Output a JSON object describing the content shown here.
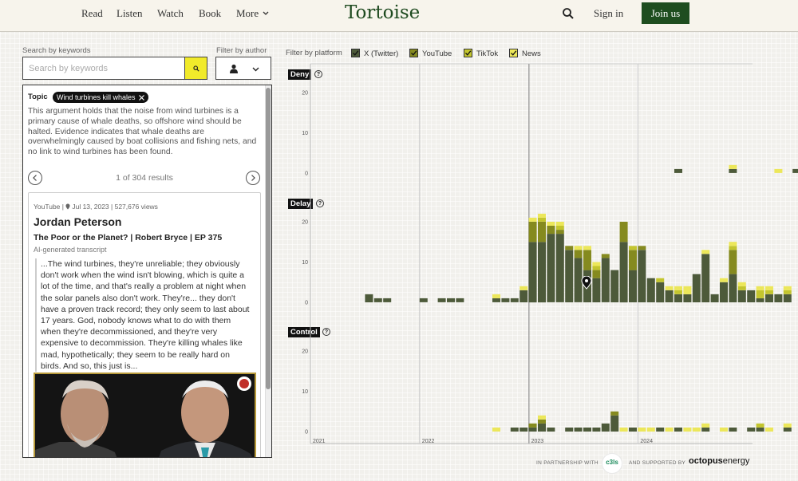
{
  "nav": {
    "items": [
      "Read",
      "Listen",
      "Watch",
      "Book",
      "More"
    ],
    "logo": "Tortoise",
    "sign_in": "Sign in",
    "join": "Join us"
  },
  "search": {
    "label": "Search by keywords",
    "placeholder": "Search by keywords",
    "author_label": "Filter by author"
  },
  "topic": {
    "label": "Topic",
    "tag": "Wind turbines kill whales",
    "description": "This argument holds that the noise from wind turbines is a primary cause of whale deaths, so offshore wind should be halted. Evidence indicates that whale deaths are overwhelmingly caused by boat collisions and fishing nets, and no link to wind turbines has been found.",
    "results": "1 of 304 results"
  },
  "result": {
    "meta": "YouTube | ",
    "date": "Jul 13, 2023 | 527,676 views",
    "author": "Jordan Peterson",
    "title": "The Poor or the Planet? | Robert Bryce | EP 375",
    "transcript_label": "AI-generated transcript",
    "quote": "...The wind turbines, they're unreliable; they obviously don't work when the wind isn't blowing, which is quite a lot of the time, and that's really a problem at night when the solar panels also don't work. They're... they don't have a proven track record; they only seem to last about 17 years. God, nobody knows what to do with them when they're decommissioned, and they're very expensive to decommission. They're killing whales like mad, hypothetically; they seem to be really hard on birds. And so, this just is..."
  },
  "filters": {
    "label": "Filter by platform",
    "platforms": [
      {
        "name": "X (Twitter)",
        "color": "#4d5a3a"
      },
      {
        "name": "YouTube",
        "color": "#858a1f"
      },
      {
        "name": "TikTok",
        "color": "#c3c52e"
      },
      {
        "name": "News",
        "color": "#ece75a"
      }
    ]
  },
  "chart_data": {
    "type": "stacked bar",
    "x_axis": [
      "2021",
      "2022",
      "2023",
      "2024"
    ],
    "y_ticks": [
      "0",
      "10",
      "20"
    ],
    "ylim": [
      0,
      22
    ],
    "series": [
      "X (Twitter)",
      "YouTube",
      "TikTok",
      "News"
    ],
    "panels": [
      {
        "name": "Deny",
        "bars": [
          {
            "month": 40,
            "values": [
              1,
              0,
              0,
              0
            ]
          },
          {
            "month": 46,
            "values": [
              1,
              0,
              0,
              1
            ]
          },
          {
            "month": 51,
            "values": [
              0,
              0,
              0,
              1
            ]
          },
          {
            "month": 53,
            "values": [
              1,
              0,
              0,
              0
            ]
          }
        ]
      },
      {
        "name": "Delay",
        "bars": [
          {
            "month": 6,
            "values": [
              2,
              0,
              0,
              0
            ]
          },
          {
            "month": 7,
            "values": [
              1,
              0,
              0,
              0
            ]
          },
          {
            "month": 8,
            "values": [
              1,
              0,
              0,
              0
            ]
          },
          {
            "month": 12,
            "values": [
              1,
              0,
              0,
              0
            ]
          },
          {
            "month": 14,
            "values": [
              1,
              0,
              0,
              0
            ]
          },
          {
            "month": 15,
            "values": [
              1,
              0,
              0,
              0
            ]
          },
          {
            "month": 16,
            "values": [
              1,
              0,
              0,
              0
            ]
          },
          {
            "month": 20,
            "values": [
              1,
              0,
              0,
              1
            ]
          },
          {
            "month": 21,
            "values": [
              1,
              0,
              0,
              0
            ]
          },
          {
            "month": 22,
            "values": [
              1,
              0,
              0,
              0
            ]
          },
          {
            "month": 23,
            "values": [
              3,
              0,
              0,
              1
            ]
          },
          {
            "month": 24,
            "values": [
              15,
              5,
              0,
              1
            ]
          },
          {
            "month": 25,
            "values": [
              15,
              5,
              1,
              1
            ]
          },
          {
            "month": 26,
            "values": [
              17,
              2,
              0,
              1
            ]
          },
          {
            "month": 27,
            "values": [
              17,
              1,
              1,
              1
            ]
          },
          {
            "month": 28,
            "values": [
              13,
              1,
              0,
              0
            ]
          },
          {
            "month": 29,
            "values": [
              11,
              2,
              0,
              1
            ]
          },
          {
            "month": 30,
            "values": [
              8,
              5,
              0,
              1
            ]
          },
          {
            "month": 31,
            "values": [
              6,
              2,
              1,
              1
            ]
          },
          {
            "month": 32,
            "values": [
              11,
              1,
              0,
              0
            ]
          },
          {
            "month": 33,
            "values": [
              8,
              0,
              0,
              0
            ]
          },
          {
            "month": 34,
            "values": [
              15,
              5,
              0,
              0
            ]
          },
          {
            "month": 35,
            "values": [
              8,
              5,
              1,
              0
            ]
          },
          {
            "month": 36,
            "values": [
              13,
              1,
              0,
              0
            ]
          },
          {
            "month": 37,
            "values": [
              6,
              0,
              0,
              0
            ]
          },
          {
            "month": 38,
            "values": [
              5,
              0,
              1,
              0
            ]
          },
          {
            "month": 39,
            "values": [
              3,
              0,
              0,
              1
            ]
          },
          {
            "month": 40,
            "values": [
              2,
              0,
              1,
              1
            ]
          },
          {
            "month": 41,
            "values": [
              2,
              0,
              0,
              2
            ]
          },
          {
            "month": 42,
            "values": [
              7,
              0,
              0,
              0
            ]
          },
          {
            "month": 43,
            "values": [
              12,
              0,
              0,
              1
            ]
          },
          {
            "month": 44,
            "values": [
              2,
              0,
              0,
              0
            ]
          },
          {
            "month": 45,
            "values": [
              5,
              0,
              0,
              1
            ]
          },
          {
            "month": 46,
            "values": [
              7,
              6,
              1,
              1
            ]
          },
          {
            "month": 47,
            "values": [
              3,
              0,
              1,
              1
            ]
          },
          {
            "month": 48,
            "values": [
              3,
              0,
              0,
              0
            ]
          },
          {
            "month": 49,
            "values": [
              1,
              0,
              2,
              1
            ]
          },
          {
            "month": 50,
            "values": [
              2,
              0,
              1,
              1
            ]
          },
          {
            "month": 51,
            "values": [
              2,
              0,
              0,
              0
            ]
          },
          {
            "month": 52,
            "values": [
              2,
              0,
              1,
              1
            ]
          }
        ]
      },
      {
        "name": "Control",
        "bars": [
          {
            "month": 20,
            "values": [
              0,
              0,
              0,
              1
            ]
          },
          {
            "month": 22,
            "values": [
              1,
              0,
              0,
              0
            ]
          },
          {
            "month": 23,
            "values": [
              1,
              0,
              0,
              0
            ]
          },
          {
            "month": 24,
            "values": [
              1,
              1,
              0,
              0
            ]
          },
          {
            "month": 25,
            "values": [
              2,
              1,
              0,
              1
            ]
          },
          {
            "month": 26,
            "values": [
              1,
              0,
              0,
              0
            ]
          },
          {
            "month": 28,
            "values": [
              1,
              0,
              0,
              0
            ]
          },
          {
            "month": 29,
            "values": [
              1,
              0,
              0,
              0
            ]
          },
          {
            "month": 30,
            "values": [
              1,
              0,
              0,
              0
            ]
          },
          {
            "month": 31,
            "values": [
              1,
              0,
              0,
              0
            ]
          },
          {
            "month": 32,
            "values": [
              2,
              0,
              0,
              0
            ]
          },
          {
            "month": 33,
            "values": [
              4,
              1,
              0,
              0
            ]
          },
          {
            "month": 34,
            "values": [
              0,
              0,
              0,
              1
            ]
          },
          {
            "month": 35,
            "values": [
              1,
              0,
              0,
              0
            ]
          },
          {
            "month": 36,
            "values": [
              0,
              0,
              0,
              1
            ]
          },
          {
            "month": 37,
            "values": [
              0,
              0,
              0,
              1
            ]
          },
          {
            "month": 38,
            "values": [
              1,
              0,
              0,
              0
            ]
          },
          {
            "month": 39,
            "values": [
              0,
              0,
              0,
              1
            ]
          },
          {
            "month": 40,
            "values": [
              1,
              0,
              0,
              0
            ]
          },
          {
            "month": 41,
            "values": [
              0,
              0,
              0,
              1
            ]
          },
          {
            "month": 42,
            "values": [
              0,
              0,
              0,
              1
            ]
          },
          {
            "month": 43,
            "values": [
              1,
              0,
              0,
              1
            ]
          },
          {
            "month": 45,
            "values": [
              0,
              0,
              0,
              1
            ]
          },
          {
            "month": 46,
            "values": [
              1,
              0,
              0,
              0
            ]
          },
          {
            "month": 48,
            "values": [
              1,
              0,
              0,
              0
            ]
          },
          {
            "month": 49,
            "values": [
              1,
              0,
              1,
              0
            ]
          },
          {
            "month": 50,
            "values": [
              0,
              0,
              0,
              1
            ]
          },
          {
            "month": 52,
            "values": [
              1,
              0,
              0,
              1
            ]
          }
        ]
      }
    ]
  },
  "footer": {
    "partnership": "IN PARTNERSHIP WITH",
    "supported": "AND SUPPORTED BY",
    "partner": "c3ls",
    "sponsor_a": "octopus",
    "sponsor_b": "energy"
  }
}
